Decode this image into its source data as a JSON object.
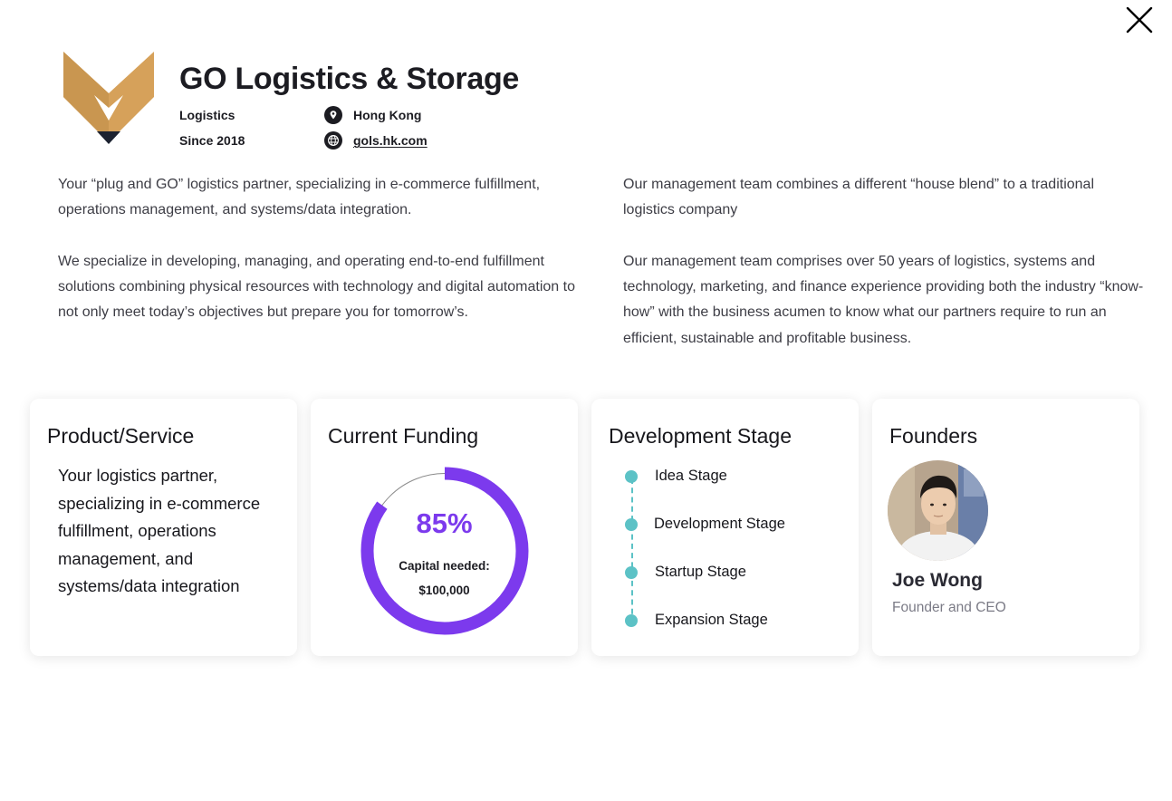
{
  "company": {
    "name": "GO Logistics & Storage",
    "industry": "Logistics",
    "since": "Since  2018",
    "location": "Hong Kong",
    "website": "gols.hk.com",
    "brand_color": "#d9a35a",
    "logo_icon": "chevron-v-logo"
  },
  "description": {
    "left": [
      "Your “plug and GO” logistics partner, specializing in e-commerce fulfillment, operations management, and systems/data integration.",
      "We specialize in developing, managing, and operating end-to-end fulfillment solutions combining physical resources with technology and digital automation to not only meet today’s objectives but prepare you for tomorrow’s."
    ],
    "right": [
      "Our management team combines a different “house blend” to a traditional logistics company",
      "Our management team comprises over 50 years of logistics, systems and technology, marketing, and finance experience providing both the industry “know-how” with the business acumen to know what our partners require to run an efficient, sustainable and profitable business."
    ]
  },
  "cards": {
    "product": {
      "title": "Product/Service",
      "text": "Your logistics partner, specializing in e-commerce fulfillment, operations management, and systems/data integration"
    },
    "funding": {
      "title": "Current Funding",
      "percent_label": "85%",
      "progress": 0.85,
      "capital_label": "Capital needed:",
      "capital_amount": "$100,000",
      "accent_color": "#7c3aed"
    },
    "stage": {
      "title": "Development Stage",
      "items": [
        "Idea Stage",
        "Development Stage",
        "Startup Stage",
        "Expansion Stage"
      ],
      "accent_color": "#5cc2c6"
    },
    "founders": {
      "title": "Founders",
      "name": "Joe Wong",
      "role": "Founder and CEO"
    }
  }
}
